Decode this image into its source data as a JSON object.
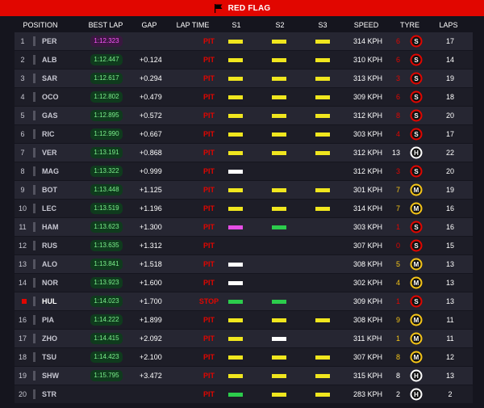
{
  "banner": {
    "title": "RED FLAG"
  },
  "columns": {
    "position": "POSITION",
    "best_lap": "BEST LAP",
    "gap": "GAP",
    "lap_time": "LAP TIME",
    "s1": "S1",
    "s2": "S2",
    "s3": "S3",
    "speed": "SPEED",
    "tyre": "TYRE",
    "laps": "LAPS"
  },
  "colors": {
    "yellow": "#f0e61e",
    "green": "#2ccc4c",
    "purple": "#e64ee6",
    "white": "#ffffff",
    "red": "#e10600",
    "soft": "#e10600",
    "medium": "#f5c518",
    "hard": "#ffffff"
  },
  "rows": [
    {
      "pos": "1",
      "code": "PER",
      "best": "1:12.323",
      "best_purple": true,
      "gap": "",
      "lap": "PIT",
      "s1": "yellow",
      "s2": "yellow",
      "s3": "yellow",
      "speed": "314 KPH",
      "tyre_age": "6",
      "tyre_color": "#e10600",
      "tyre_letter": "S",
      "laps": "17"
    },
    {
      "pos": "2",
      "code": "ALB",
      "best": "1:12.447",
      "gap": "+0.124",
      "lap": "PIT",
      "s1": "yellow",
      "s2": "yellow",
      "s3": "yellow",
      "speed": "310 KPH",
      "tyre_age": "6",
      "tyre_color": "#e10600",
      "tyre_letter": "S",
      "laps": "14"
    },
    {
      "pos": "3",
      "code": "SAR",
      "best": "1:12.617",
      "gap": "+0.294",
      "lap": "PIT",
      "s1": "yellow",
      "s2": "yellow",
      "s3": "yellow",
      "speed": "313 KPH",
      "tyre_age": "3",
      "tyre_color": "#e10600",
      "tyre_letter": "S",
      "laps": "19"
    },
    {
      "pos": "4",
      "code": "OCO",
      "best": "1:12.802",
      "gap": "+0.479",
      "lap": "PIT",
      "s1": "yellow",
      "s2": "yellow",
      "s3": "yellow",
      "speed": "309 KPH",
      "tyre_age": "6",
      "tyre_color": "#e10600",
      "tyre_letter": "S",
      "laps": "18"
    },
    {
      "pos": "5",
      "code": "GAS",
      "best": "1:12.895",
      "gap": "+0.572",
      "lap": "PIT",
      "s1": "yellow",
      "s2": "yellow",
      "s3": "yellow",
      "speed": "312 KPH",
      "tyre_age": "8",
      "tyre_color": "#e10600",
      "tyre_letter": "S",
      "laps": "20"
    },
    {
      "pos": "6",
      "code": "RIC",
      "best": "1:12.990",
      "gap": "+0.667",
      "lap": "PIT",
      "s1": "yellow",
      "s2": "yellow",
      "s3": "yellow",
      "speed": "303 KPH",
      "tyre_age": "4",
      "tyre_color": "#e10600",
      "tyre_letter": "S",
      "laps": "17"
    },
    {
      "pos": "7",
      "code": "VER",
      "best": "1:13.191",
      "gap": "+0.868",
      "lap": "PIT",
      "s1": "yellow",
      "s2": "yellow",
      "s3": "yellow",
      "speed": "312 KPH",
      "tyre_age": "13",
      "tyre_color": "#ffffff",
      "tyre_letter": "H",
      "laps": "22"
    },
    {
      "pos": "8",
      "code": "MAG",
      "best": "1:13.322",
      "gap": "+0.999",
      "lap": "PIT",
      "s1": "white",
      "s2": "",
      "s3": "",
      "speed": "312 KPH",
      "tyre_age": "3",
      "tyre_color": "#e10600",
      "tyre_letter": "S",
      "laps": "20"
    },
    {
      "pos": "9",
      "code": "BOT",
      "best": "1:13.448",
      "gap": "+1.125",
      "lap": "PIT",
      "s1": "yellow",
      "s2": "yellow",
      "s3": "yellow",
      "speed": "301 KPH",
      "tyre_age": "7",
      "tyre_color": "#f5c518",
      "tyre_letter": "M",
      "laps": "19"
    },
    {
      "pos": "10",
      "code": "LEC",
      "best": "1:13.519",
      "gap": "+1.196",
      "lap": "PIT",
      "s1": "yellow",
      "s2": "yellow",
      "s3": "yellow",
      "speed": "314 KPH",
      "tyre_age": "7",
      "tyre_color": "#f5c518",
      "tyre_letter": "M",
      "laps": "16"
    },
    {
      "pos": "11",
      "code": "HAM",
      "best": "1:13.623",
      "gap": "+1.300",
      "lap": "PIT",
      "s1": "purple",
      "s2": "green",
      "s3": "",
      "speed": "303 KPH",
      "tyre_age": "1",
      "tyre_color": "#e10600",
      "tyre_letter": "S",
      "laps": "16"
    },
    {
      "pos": "12",
      "code": "RUS",
      "best": "1:13.635",
      "gap": "+1.312",
      "lap": "PIT",
      "s1": "",
      "s2": "",
      "s3": "",
      "speed": "307 KPH",
      "tyre_age": "0",
      "tyre_color": "#e10600",
      "tyre_letter": "S",
      "laps": "15"
    },
    {
      "pos": "13",
      "code": "ALO",
      "best": "1:13.841",
      "gap": "+1.518",
      "lap": "PIT",
      "s1": "white",
      "s2": "",
      "s3": "",
      "speed": "308 KPH",
      "tyre_age": "5",
      "tyre_color": "#f5c518",
      "tyre_letter": "M",
      "laps": "13"
    },
    {
      "pos": "14",
      "code": "NOR",
      "best": "1:13.923",
      "gap": "+1.600",
      "lap": "PIT",
      "s1": "white",
      "s2": "",
      "s3": "",
      "speed": "302 KPH",
      "tyre_age": "4",
      "tyre_color": "#f5c518",
      "tyre_letter": "M",
      "laps": "13"
    },
    {
      "pos": "",
      "code": "HUL",
      "best": "1:14.023",
      "gap": "+1.700",
      "lap": "STOP",
      "s1": "green",
      "s2": "green",
      "s3": "",
      "speed": "309 KPH",
      "tyre_age": "1",
      "tyre_color": "#e10600",
      "tyre_letter": "S",
      "laps": "13",
      "active": true
    },
    {
      "pos": "16",
      "code": "PIA",
      "best": "1:14.222",
      "gap": "+1.899",
      "lap": "PIT",
      "s1": "yellow",
      "s2": "yellow",
      "s3": "yellow",
      "speed": "308 KPH",
      "tyre_age": "9",
      "tyre_color": "#f5c518",
      "tyre_letter": "M",
      "laps": "11"
    },
    {
      "pos": "17",
      "code": "ZHO",
      "best": "1:14.415",
      "gap": "+2.092",
      "lap": "PIT",
      "s1": "yellow",
      "s2": "white",
      "s3": "",
      "speed": "311 KPH",
      "tyre_age": "1",
      "tyre_color": "#f5c518",
      "tyre_letter": "M",
      "laps": "11"
    },
    {
      "pos": "18",
      "code": "TSU",
      "best": "1:14.423",
      "gap": "+2.100",
      "lap": "PIT",
      "s1": "yellow",
      "s2": "yellow",
      "s3": "yellow",
      "speed": "307 KPH",
      "tyre_age": "8",
      "tyre_color": "#f5c518",
      "tyre_letter": "M",
      "laps": "12"
    },
    {
      "pos": "19",
      "code": "SHW",
      "best": "1:15.795",
      "gap": "+3.472",
      "lap": "PIT",
      "s1": "yellow",
      "s2": "yellow",
      "s3": "yellow",
      "speed": "315 KPH",
      "tyre_age": "8",
      "tyre_color": "#ffffff",
      "tyre_letter": "H",
      "laps": "13"
    },
    {
      "pos": "20",
      "code": "STR",
      "best": "",
      "gap": "",
      "lap": "PIT",
      "s1": "green",
      "s2": "yellow",
      "s3": "yellow",
      "speed": "283 KPH",
      "tyre_age": "2",
      "tyre_color": "#ffffff",
      "tyre_letter": "H",
      "laps": "2"
    }
  ]
}
